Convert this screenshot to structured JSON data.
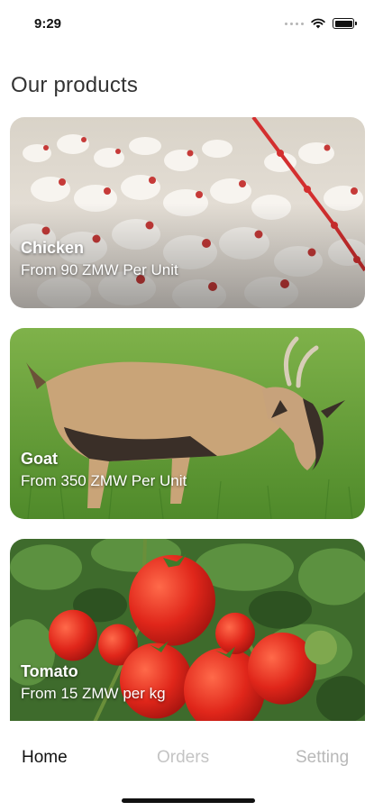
{
  "status_bar": {
    "time": "9:29"
  },
  "page": {
    "title": "Our products"
  },
  "products": [
    {
      "name": "Chicken",
      "price": "From 90 ZMW Per Unit"
    },
    {
      "name": "Goat",
      "price": "From 350 ZMW Per Unit"
    },
    {
      "name": "Tomato",
      "price": "From 15 ZMW per kg"
    }
  ],
  "bottom_nav": {
    "items": [
      {
        "label": "Home",
        "active": true
      },
      {
        "label": "Orders",
        "active": false
      },
      {
        "label": "Setting",
        "active": false
      }
    ]
  },
  "colors": {
    "active_tab": "#111111",
    "inactive_tab": "#c4c4c4",
    "background": "#ffffff"
  },
  "icons": [
    "signal-dots-icon",
    "wifi-icon",
    "battery-icon"
  ]
}
